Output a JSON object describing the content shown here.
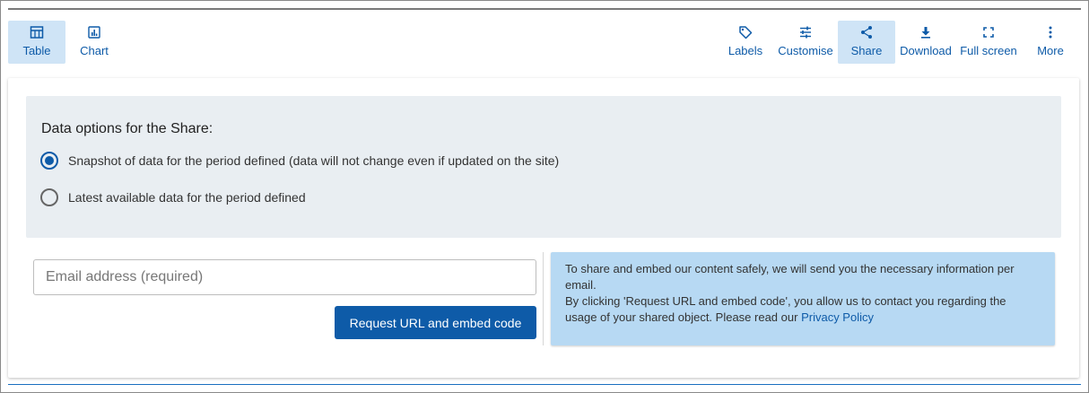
{
  "toolbar": {
    "left": [
      {
        "label": "Table",
        "icon": "table-icon",
        "active": true
      },
      {
        "label": "Chart",
        "icon": "chart-icon",
        "active": false
      }
    ],
    "right": [
      {
        "label": "Labels",
        "icon": "tag-icon",
        "active": false
      },
      {
        "label": "Customise",
        "icon": "sliders-icon",
        "active": false
      },
      {
        "label": "Share",
        "icon": "share-icon",
        "active": true
      },
      {
        "label": "Download",
        "icon": "download-icon",
        "active": false
      },
      {
        "label": "Full screen",
        "icon": "fullscreen-icon",
        "active": false
      },
      {
        "label": "More",
        "icon": "more-vertical-icon",
        "active": false
      }
    ]
  },
  "share": {
    "options_title": "Data options for the Share:",
    "options": [
      {
        "label": "Snapshot of data for the period defined (data will not change even if updated on the site)",
        "checked": true
      },
      {
        "label": "Latest available data for the period defined",
        "checked": false
      }
    ],
    "email_placeholder": "Email address (required)",
    "email_value": "",
    "request_button": "Request URL and embed code",
    "info_line1": "To share and embed our content safely, we will send you the necessary information per email.",
    "info_line2": "By clicking 'Request URL and embed code', you allow us to contact you regarding the usage of your shared object. Please read our",
    "privacy_link": "Privacy Policy"
  },
  "colors": {
    "accent": "#0e5ba8",
    "active_tab_bg": "#cfe4f6",
    "options_bg": "#e9eef2",
    "info_bg": "#b7d9f3"
  }
}
